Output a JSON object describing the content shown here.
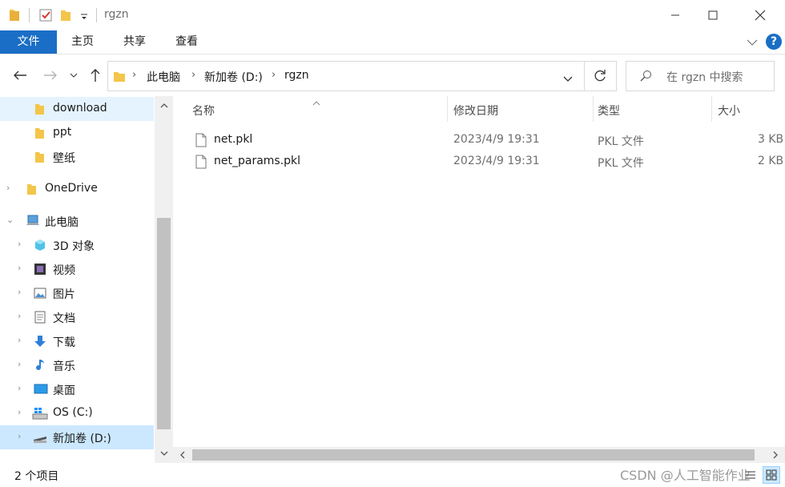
{
  "window": {
    "title": "rgzn"
  },
  "ribbon": {
    "tabs": [
      {
        "label": "文件"
      },
      {
        "label": "主页"
      },
      {
        "label": "共享"
      },
      {
        "label": "查看"
      }
    ],
    "help_label": "?"
  },
  "address": {
    "crumbs": [
      "此电脑",
      "新加卷 (D:)",
      "rgzn"
    ]
  },
  "search": {
    "placeholder": "在 rgzn 中搜索"
  },
  "nav": {
    "items": [
      {
        "label": "download"
      },
      {
        "label": "ppt"
      },
      {
        "label": "壁纸"
      },
      {
        "label": "OneDrive"
      },
      {
        "label": "此电脑"
      },
      {
        "label": "3D 对象"
      },
      {
        "label": "视频"
      },
      {
        "label": "图片"
      },
      {
        "label": "文档"
      },
      {
        "label": "下载"
      },
      {
        "label": "音乐"
      },
      {
        "label": "桌面"
      },
      {
        "label": "OS (C:)"
      },
      {
        "label": "新加卷 (D:)"
      }
    ]
  },
  "columns": {
    "name": "名称",
    "date": "修改日期",
    "type": "类型",
    "size": "大小"
  },
  "files": [
    {
      "name": "net.pkl",
      "date": "2023/4/9 19:31",
      "type": "PKL 文件",
      "size": "3 KB"
    },
    {
      "name": "net_params.pkl",
      "date": "2023/4/9 19:31",
      "type": "PKL 文件",
      "size": "2 KB"
    }
  ],
  "status": {
    "count": "2 个项目",
    "watermark": "CSDN @人工智能作业"
  },
  "colors": {
    "accent": "#1a6ec5",
    "selected": "#cce8ff",
    "hover": "#e5f3ff",
    "folder": "#f3c54a"
  }
}
